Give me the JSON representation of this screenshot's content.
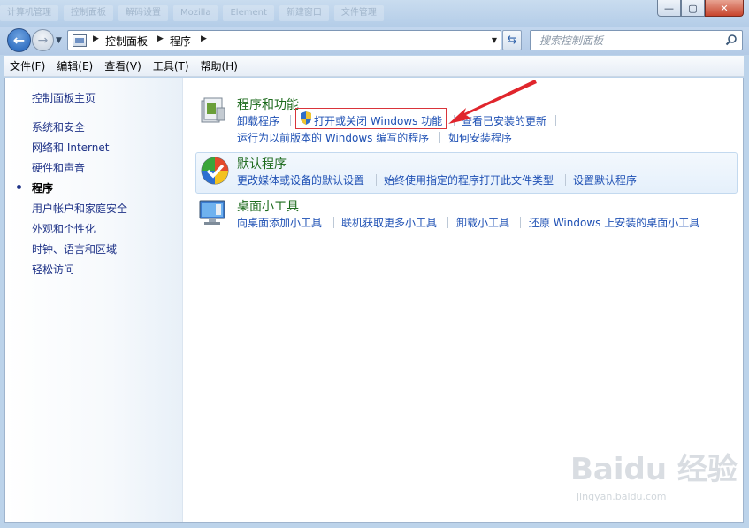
{
  "window": {
    "background_tabs": [
      "计算机管理",
      "控制面板",
      "解码设置",
      "Mozilla",
      "Element",
      "新建窗口",
      "文件管理"
    ],
    "controls": {
      "minimize": "—",
      "maximize": "▢",
      "close": "✕"
    }
  },
  "address_bar": {
    "breadcrumb": [
      "控制面板",
      "程序"
    ],
    "search_placeholder": "搜索控制面板"
  },
  "menu": [
    "文件(F)",
    "编辑(E)",
    "查看(V)",
    "工具(T)",
    "帮助(H)"
  ],
  "sidebar": {
    "items": [
      {
        "label": "控制面板主页",
        "current": false
      },
      {
        "label": "系统和安全",
        "current": false
      },
      {
        "label": "网络和 Internet",
        "current": false
      },
      {
        "label": "硬件和声音",
        "current": false
      },
      {
        "label": "程序",
        "current": true
      },
      {
        "label": "用户帐户和家庭安全",
        "current": false
      },
      {
        "label": "外观和个性化",
        "current": false
      },
      {
        "label": "时钟、语言和区域",
        "current": false
      },
      {
        "label": "轻松访问",
        "current": false
      }
    ]
  },
  "categories": [
    {
      "title": "程序和功能",
      "icon": "programs-features-icon",
      "tasks_row1": [
        "卸载程序",
        "打开或关闭 Windows 功能",
        "查看已安装的更新"
      ],
      "tasks_row2": [
        "运行为以前版本的 Windows 编写的程序",
        "如何安装程序"
      ]
    },
    {
      "title": "默认程序",
      "icon": "default-programs-icon",
      "tasks_row1": [
        "更改媒体或设备的默认设置",
        "始终使用指定的程序打开此文件类型",
        "设置默认程序"
      ]
    },
    {
      "title": "桌面小工具",
      "icon": "desktop-gadgets-icon",
      "tasks_row1": [
        "向桌面添加小工具",
        "联机获取更多小工具",
        "卸载小工具",
        "还原 Windows 上安装的桌面小工具"
      ]
    }
  ],
  "annotation": {
    "highlight_color": "#d9343a"
  },
  "watermark": {
    "brand": "Baidu 经验",
    "url": "jingyan.baidu.com"
  },
  "colors": {
    "link": "#1e50b4",
    "category_title": "#1e6b1e",
    "sidebar_link": "#1e3287"
  }
}
